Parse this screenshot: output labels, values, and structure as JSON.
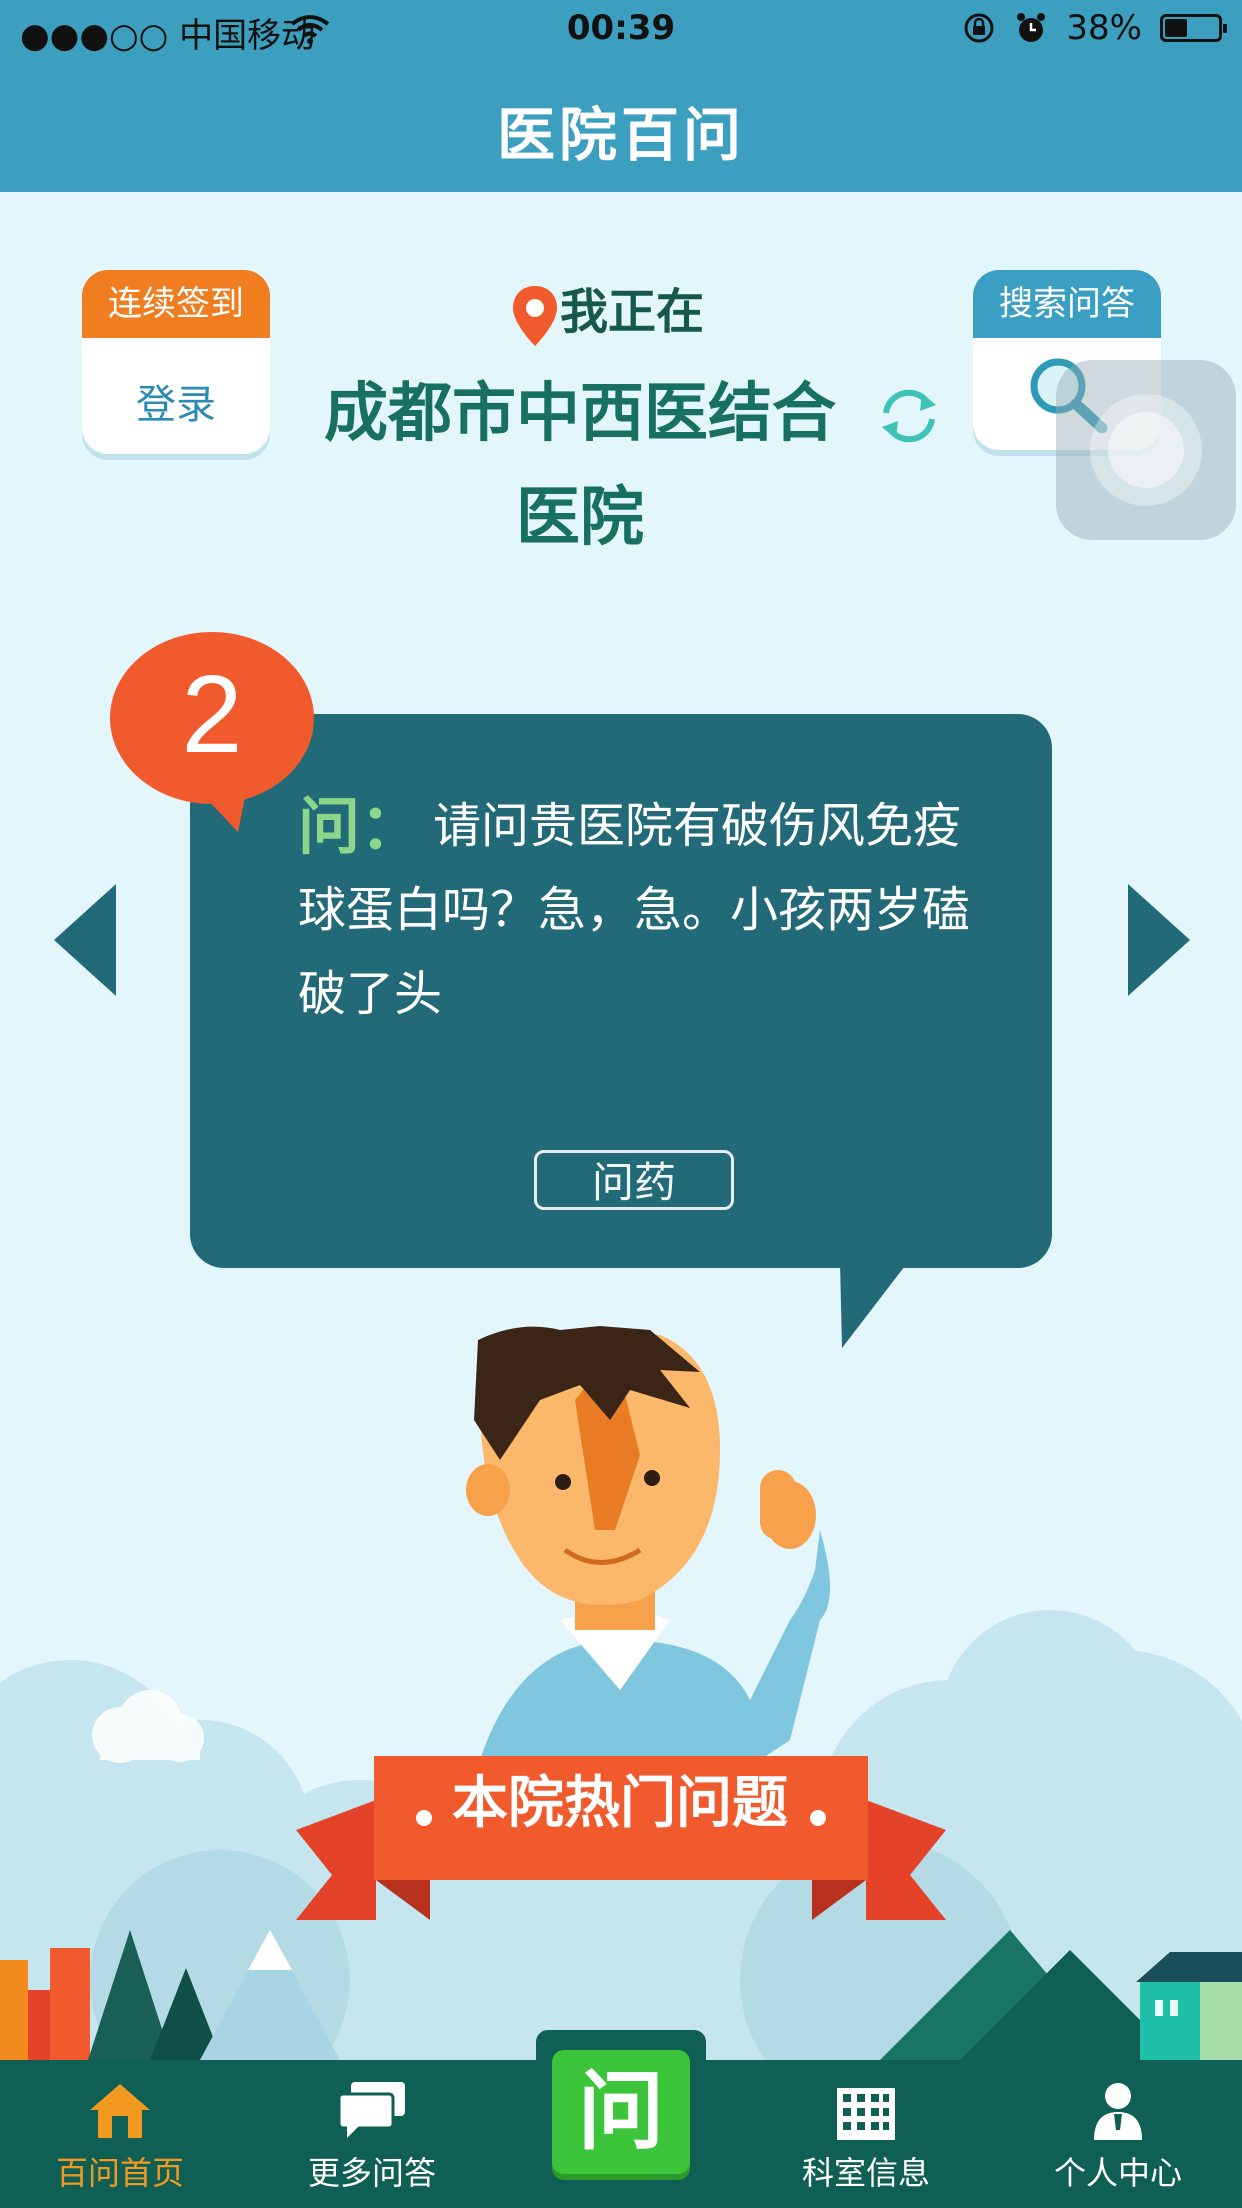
{
  "status_bar": {
    "carrier": "●●●○○ 中国移动",
    "time": "00:39",
    "battery": "38%",
    "battery_level": 0.38
  },
  "header": {
    "title": "医院百问"
  },
  "checkin": {
    "label": "连续签到",
    "action": "登录"
  },
  "search": {
    "label": "搜索问答"
  },
  "location": {
    "label": "我正在",
    "hospital": "成都市中西医结合医院"
  },
  "question_card": {
    "number": "2",
    "prefix": "问：",
    "text": "请问贵医院有破伤风免疫球蛋白吗？急，急。小孩两岁磕破了头",
    "tag": "问药"
  },
  "banner": {
    "text": "本院热门问题"
  },
  "tabbar": {
    "items": [
      {
        "label": "百问首页",
        "icon": "home-icon",
        "active": true
      },
      {
        "label": "更多问答",
        "icon": "chat-bubbles-icon",
        "active": false
      },
      {
        "label": "问",
        "icon": "ask-icon",
        "active": false
      },
      {
        "label": "科室信息",
        "icon": "building-icon",
        "active": false
      },
      {
        "label": "个人中心",
        "icon": "person-icon",
        "active": false
      }
    ]
  },
  "colors": {
    "header": "#3d9fc0",
    "accent_orange": "#f07d20",
    "bubble": "#236a79",
    "tabbar": "#0f5f55",
    "ask_button": "#3cc43a",
    "active_tab": "#f29a20"
  }
}
